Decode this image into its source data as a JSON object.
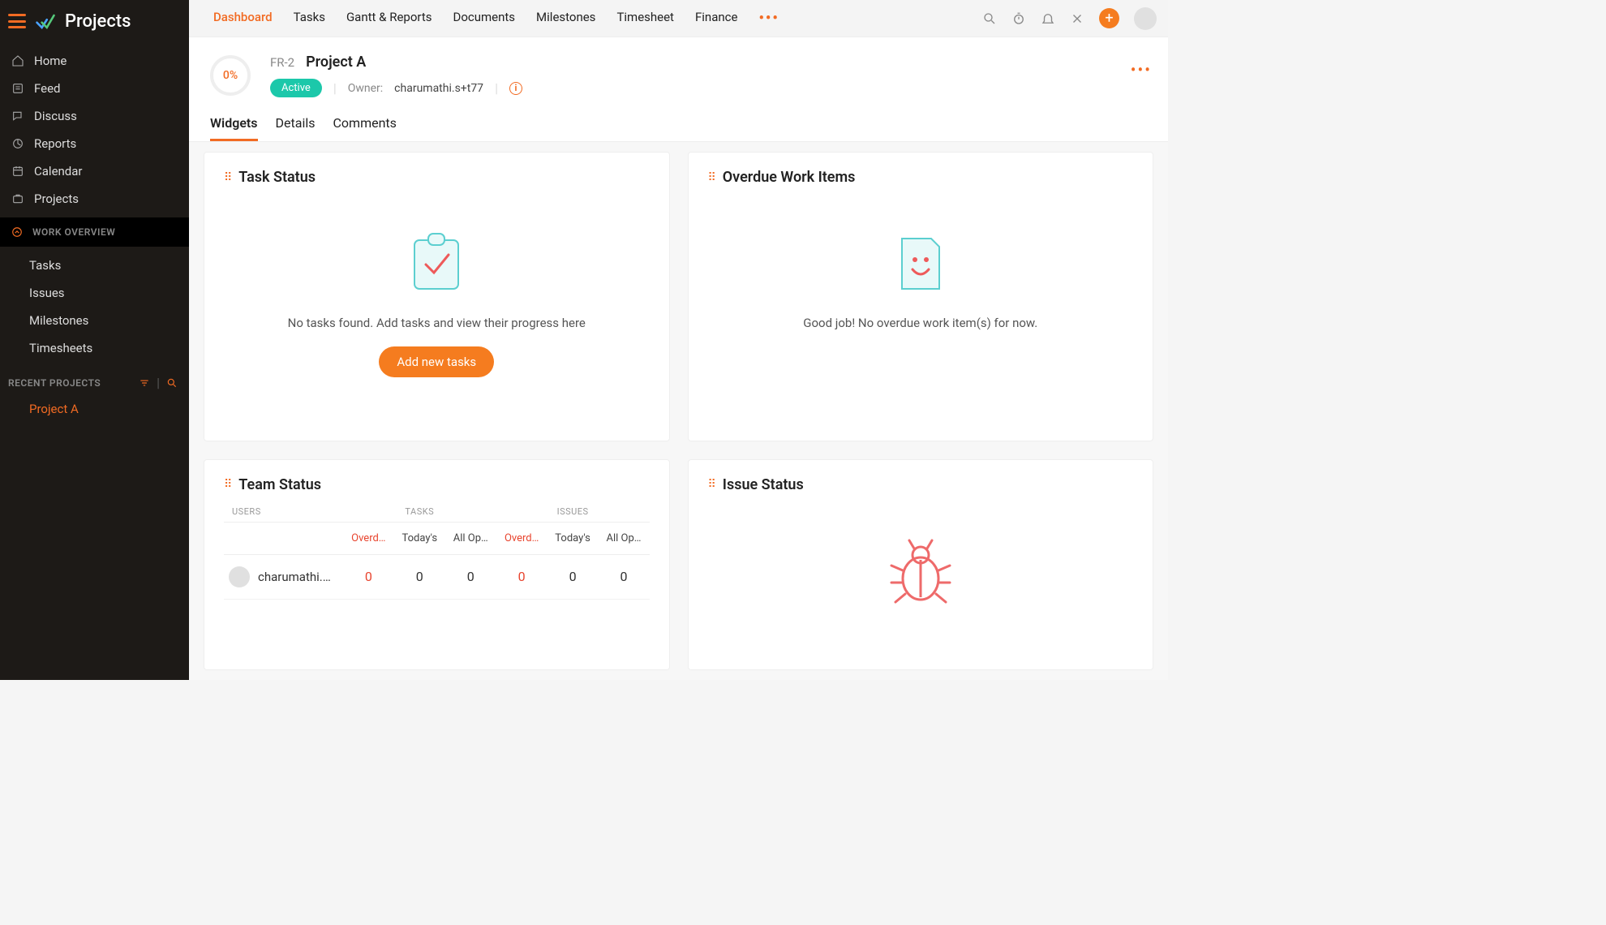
{
  "brand": "Projects",
  "sidebar": {
    "items": [
      {
        "label": "Home"
      },
      {
        "label": "Feed"
      },
      {
        "label": "Discuss"
      },
      {
        "label": "Reports"
      },
      {
        "label": "Calendar"
      },
      {
        "label": "Projects"
      }
    ],
    "work_overview": "WORK OVERVIEW",
    "work_items": [
      {
        "label": "Tasks"
      },
      {
        "label": "Issues"
      },
      {
        "label": "Milestones"
      },
      {
        "label": "Timesheets"
      }
    ],
    "recent_title": "RECENT PROJECTS",
    "recent_project": "Project A"
  },
  "topnav": {
    "tabs": [
      "Dashboard",
      "Tasks",
      "Gantt & Reports",
      "Documents",
      "Milestones",
      "Timesheet",
      "Finance"
    ]
  },
  "project": {
    "progress": "0%",
    "code": "FR-2",
    "name": "Project A",
    "status": "Active",
    "owner_label": "Owner:",
    "owner": "charumathi.s+t77"
  },
  "subtabs": [
    "Widgets",
    "Details",
    "Comments"
  ],
  "widgets": {
    "task_status": {
      "title": "Task Status",
      "empty": "No tasks found. Add tasks and view their progress here",
      "button": "Add new tasks"
    },
    "overdue": {
      "title": "Overdue Work Items",
      "empty": "Good job! No overdue work item(s) for now."
    },
    "team": {
      "title": "Team Status",
      "col_users": "USERS",
      "col_tasks": "TASKS",
      "col_issues": "ISSUES",
      "subcols": [
        "Overd…",
        "Today's",
        "All Op…",
        "Overd…",
        "Today's",
        "All Op…"
      ],
      "row": {
        "user": "charumathi.…",
        "vals": [
          "0",
          "0",
          "0",
          "0",
          "0",
          "0"
        ]
      }
    },
    "issue": {
      "title": "Issue Status"
    }
  }
}
